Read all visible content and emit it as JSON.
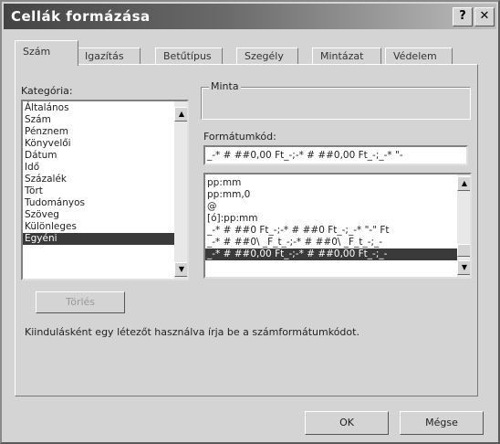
{
  "window": {
    "title": "Cellák formázása",
    "help_label": "?",
    "close_label": "✕"
  },
  "tabs": [
    {
      "label": "Szám",
      "active": true
    },
    {
      "label": "Igazítás",
      "active": false
    },
    {
      "label": "Betűtípus",
      "active": false
    },
    {
      "label": "Szegély",
      "active": false
    },
    {
      "label": "Mintázat",
      "active": false
    },
    {
      "label": "Védelem",
      "active": false
    }
  ],
  "category": {
    "label": "Kategória:",
    "items": [
      "Általános",
      "Szám",
      "Pénznem",
      "Könyvelői",
      "Dátum",
      "Idő",
      "Százalék",
      "Tört",
      "Tudományos",
      "Szöveg",
      "Különleges",
      "Egyéni"
    ],
    "selected": "Egyéni"
  },
  "sample": {
    "label": "Minta",
    "value": ""
  },
  "format_code": {
    "label": "Formátumkód:",
    "value": "_-* # ##0,00 Ft_-;-* # ##0,00 Ft_-;_-* \"-",
    "items": [
      "pp:mm",
      "pp:mm,0",
      "@",
      "[ó]:pp:mm",
      "_-* # ##0 Ft_-;-* # ##0 Ft_-;_-* \"-\" Ft",
      "_-* # ##0\\ _F_t_-;-* # ##0\\ _F_t_-;_-",
      "_-* # ##0,00 Ft_-;-* # ##0,00 Ft_-;_-"
    ],
    "selected": "_-* # ##0,00 Ft_-;-* # ##0,00 Ft_-;_-"
  },
  "delete_label": "Törlés",
  "hint": "Kiindulásként egy létezőt használva írja be a számformátumkódot.",
  "ok_label": "OK",
  "cancel_label": "Mégse",
  "scroll_up": "▲",
  "scroll_down": "▼"
}
